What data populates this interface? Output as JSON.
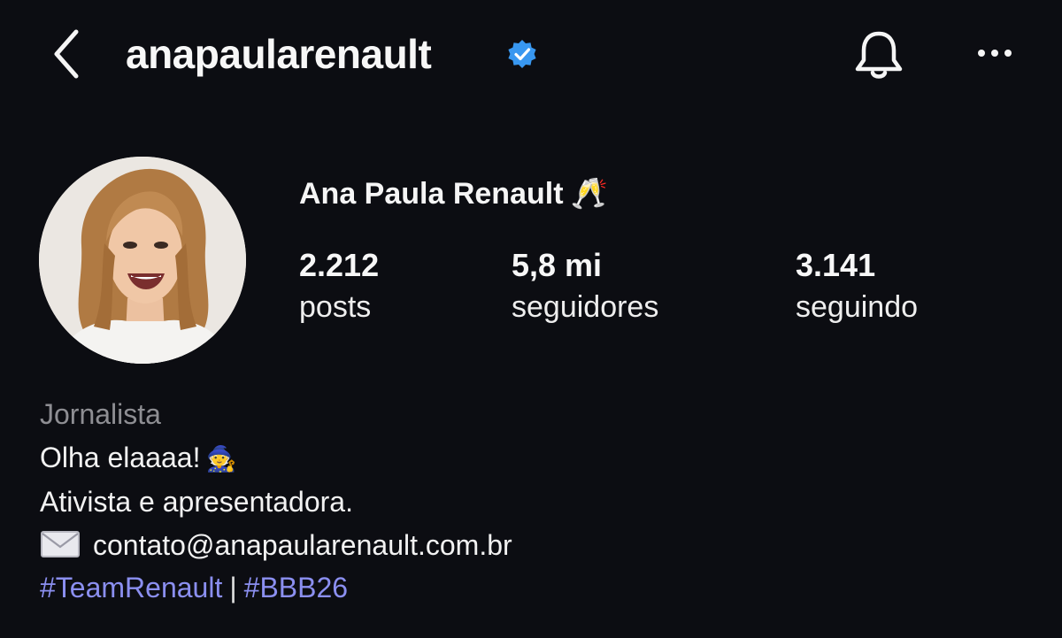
{
  "header": {
    "username": "anapaularenault",
    "verified": true,
    "icons": [
      "back-chevron-icon",
      "verified-badge-icon",
      "bell-icon",
      "more-horizontal-icon"
    ]
  },
  "profile": {
    "display_name": "Ana Paula Renault",
    "name_emoji": "🥂",
    "stats": {
      "posts": {
        "value": "2.212",
        "label": "posts"
      },
      "followers": {
        "value": "5,8 mi",
        "label": "seguidores"
      },
      "following": {
        "value": "3.141",
        "label": "seguindo"
      }
    }
  },
  "bio": {
    "category": "Jornalista",
    "line1": "Olha elaaaa!",
    "line1_emoji": "🧙",
    "line2": "Ativista e apresentadora.",
    "email": "contato@anapaularenault.com.br",
    "hashtag1": "#TeamRenault",
    "separator": "|",
    "hashtag2": "#BBB26"
  },
  "colors": {
    "background": "#0c0d12",
    "text": "#f5f5f5",
    "muted": "#8e8e93",
    "link": "#8b8ff0",
    "verified": "#3897f0"
  }
}
